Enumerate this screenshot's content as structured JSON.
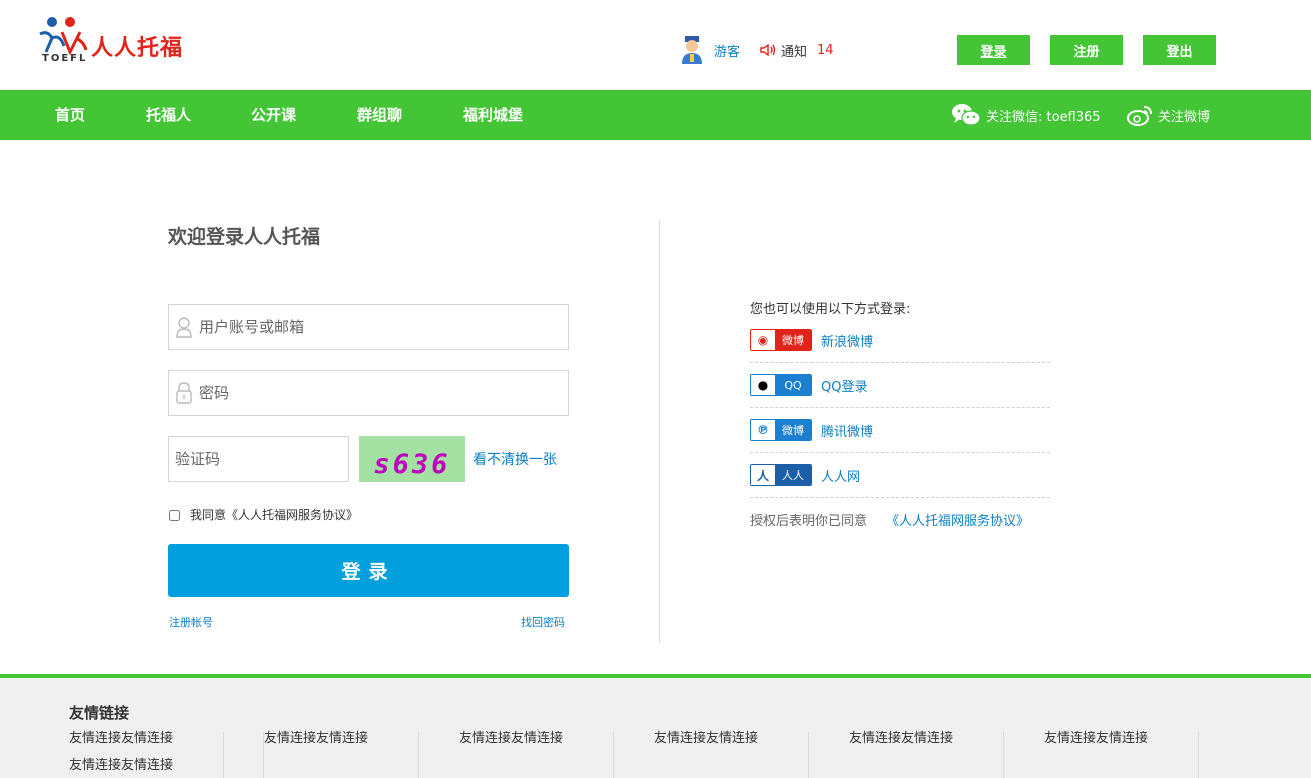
{
  "header": {
    "logo_text": "人人托福",
    "logo_sub": "TOEFL",
    "guest_label": "游客",
    "notice_label": "通知",
    "notice_count": "14",
    "login_label": "登录",
    "register_label": "注册",
    "logout_label": "登出"
  },
  "nav": {
    "items": [
      "首页",
      "托福人",
      "公开课",
      "群组聊",
      "福利城堡"
    ],
    "wechat_label": "关注微信: toefl365",
    "weibo_label": "关注微博"
  },
  "login": {
    "title": "欢迎登录人人托福",
    "username_placeholder": "用户账号或邮箱",
    "password_placeholder": "密码",
    "captcha_placeholder": "验证码",
    "captcha_text": "s636",
    "refresh_label": "看不清换一张",
    "agree_label": "我同意《人人托福网服务协议》",
    "submit_label": "登录",
    "register_link": "注册帐号",
    "forgot_link": "找回密码"
  },
  "third_party": {
    "title": "您也可以使用以下方式登录:",
    "providers": [
      {
        "badge": "微博",
        "label": "新浪微博",
        "color": "#e2231a"
      },
      {
        "badge": "QQ",
        "label": "QQ登录",
        "color": "#1a7fd0"
      },
      {
        "badge": "微博",
        "label": "腾讯微博",
        "color": "#1a7fd0"
      },
      {
        "badge": "人人",
        "label": "人人网",
        "color": "#1a5fa8"
      }
    ],
    "auth_note": "授权后表明你已同意",
    "auth_link": "《人人托福网服务协议》"
  },
  "footer": {
    "title": "友情链接",
    "col_text": "友情连接友情连接"
  }
}
